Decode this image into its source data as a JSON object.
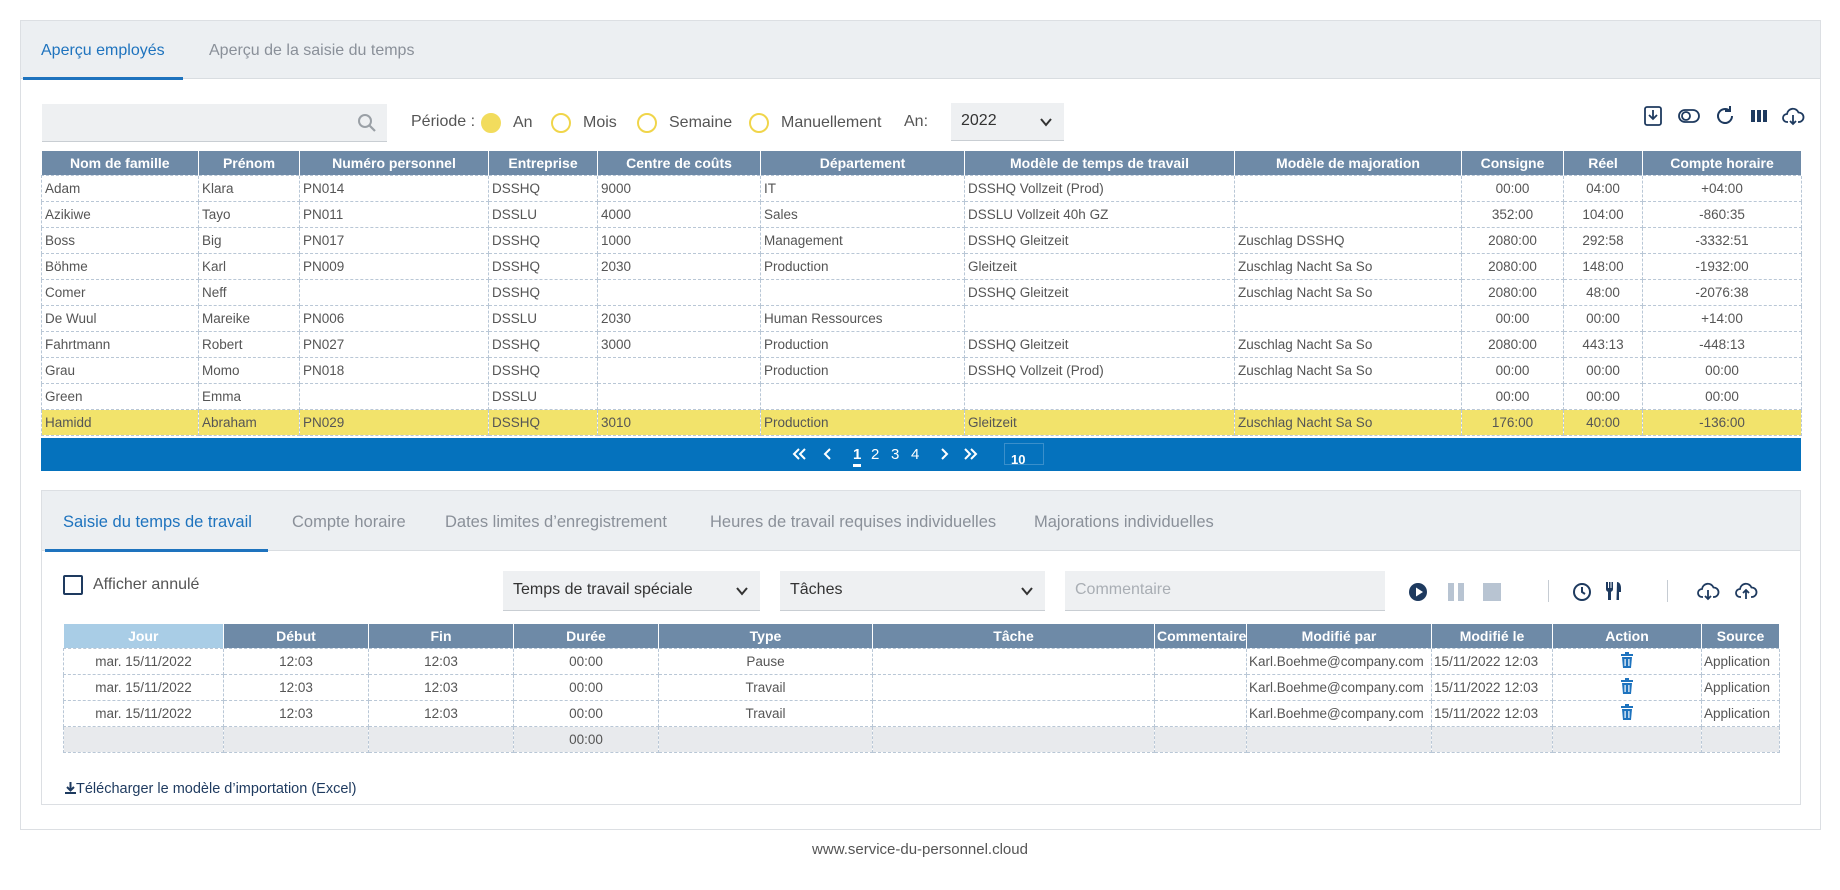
{
  "main_tabs": [
    "Aperçu employés",
    "Aperçu de la saisie du temps"
  ],
  "search": {
    "placeholder": ""
  },
  "period": {
    "label": "Période :",
    "options": [
      "An",
      "Mois",
      "Semaine",
      "Manuellement"
    ],
    "selected": "An",
    "year_label": "An:",
    "year_value": "2022"
  },
  "toolbar_icons": [
    "download-icon",
    "toggle-icon",
    "refresh-icon",
    "columns-icon",
    "cloud-download-icon"
  ],
  "employees": {
    "columns": [
      "Nom de famille",
      "Prénom",
      "Numéro personnel",
      "Entreprise",
      "Centre de coûts",
      "Département",
      "Modèle de temps de travail",
      "Modèle de majoration",
      "Consigne",
      "Réel",
      "Compte horaire"
    ],
    "rows": [
      [
        "Adam",
        "Klara",
        "PN014",
        "DSSHQ",
        "9000",
        "IT",
        "DSSHQ Vollzeit (Prod)",
        "",
        "00:00",
        "04:00",
        "+04:00"
      ],
      [
        "Azikiwe",
        "Tayo",
        "PN011",
        "DSSLU",
        "4000",
        "Sales",
        "DSSLU Vollzeit 40h GZ",
        "",
        "352:00",
        "104:00",
        "-860:35"
      ],
      [
        "Boss",
        "Big",
        "PN017",
        "DSSHQ",
        "1000",
        "Management",
        "DSSHQ Gleitzeit",
        "Zuschlag DSSHQ",
        "2080:00",
        "292:58",
        "-3332:51"
      ],
      [
        "Böhme",
        "Karl",
        "PN009",
        "DSSHQ",
        "2030",
        "Production",
        "Gleitzeit",
        "Zuschlag Nacht Sa So",
        "2080:00",
        "148:00",
        "-1932:00"
      ],
      [
        "Comer",
        "Neff",
        "",
        "DSSHQ",
        "",
        "",
        "DSSHQ Gleitzeit",
        "Zuschlag Nacht Sa So",
        "2080:00",
        "48:00",
        "-2076:38"
      ],
      [
        "De Wuul",
        "Mareike",
        "PN006",
        "DSSLU",
        "2030",
        "Human Ressources",
        "",
        "",
        "00:00",
        "00:00",
        "+14:00"
      ],
      [
        "Fahrtmann",
        "Robert",
        "PN027",
        "DSSHQ",
        "3000",
        "Production",
        "DSSHQ Gleitzeit",
        "Zuschlag Nacht Sa So",
        "2080:00",
        "443:13",
        "-448:13"
      ],
      [
        "Grau",
        "Momo",
        "PN018",
        "DSSHQ",
        "",
        "Production",
        "DSSHQ Vollzeit (Prod)",
        "Zuschlag Nacht Sa So",
        "00:00",
        "00:00",
        "00:00"
      ],
      [
        "Green",
        "Emma",
        "",
        "DSSLU",
        "",
        "",
        "",
        "",
        "00:00",
        "00:00",
        "00:00"
      ],
      [
        "Hamidd",
        "Abraham",
        "PN029",
        "DSSHQ",
        "3010",
        "Production",
        "Gleitzeit",
        "Zuschlag Nacht Sa So",
        "176:00",
        "40:00",
        "-136:00"
      ]
    ],
    "selected_row": 9
  },
  "pager": {
    "first": "«",
    "prev": "‹",
    "pages": [
      "1",
      "2",
      "3",
      "4"
    ],
    "current": "1",
    "next": "›",
    "last": "»",
    "page_size": "10"
  },
  "lower_tabs": [
    "Saisie du temps de travail",
    "Compte horaire",
    "Dates limites d’enregistrement",
    "Heures de travail requises individuelles",
    "Majorations individuelles"
  ],
  "controls": {
    "show_cancelled": "Afficher annulé",
    "type_select": "Temps de travail spéciale",
    "task_select": "Tâches",
    "comment_placeholder": "Commentaire"
  },
  "time_entries": {
    "columns": [
      "Jour",
      "Début",
      "Fin",
      "Durée",
      "Type",
      "Tâche",
      "Commentaire",
      "Modifié par",
      "Modifié le",
      "Action",
      "Source"
    ],
    "rows": [
      [
        "mar. 15/11/2022",
        "12:03",
        "12:03",
        "00:00",
        "Pause",
        "",
        "",
        "Karl.Boehme@company.com",
        "15/11/2022 12:03",
        "",
        "Application"
      ],
      [
        "mar. 15/11/2022",
        "12:03",
        "12:03",
        "00:00",
        "Travail",
        "",
        "",
        "Karl.Boehme@company.com",
        "15/11/2022 12:03",
        "",
        "Application"
      ],
      [
        "mar. 15/11/2022",
        "12:03",
        "12:03",
        "00:00",
        "Travail",
        "",
        "",
        "Karl.Boehme@company.com",
        "15/11/2022 12:03",
        "",
        "Application"
      ]
    ],
    "total_duration": "00:00"
  },
  "download_link": "Télécharger le modèle d’importation (Excel)",
  "footer": "www.service-du-personnel.cloud",
  "colors": {
    "accent": "#1e73be",
    "header": "#6e8aa7",
    "pager": "#0572bd",
    "selected_row": "#f2e36b",
    "radio": "#f2dc5d"
  }
}
